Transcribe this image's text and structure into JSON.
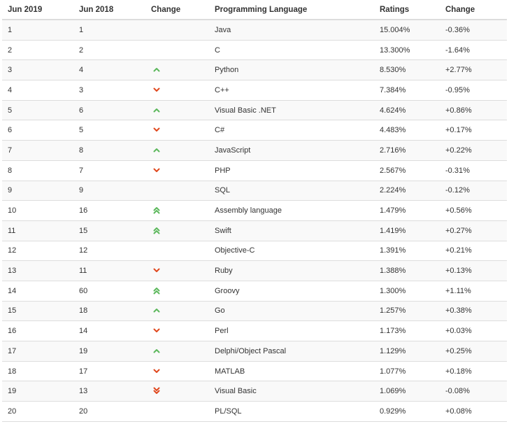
{
  "table": {
    "headers": [
      "Jun 2019",
      "Jun 2018",
      "Change",
      "Programming Language",
      "Ratings",
      "Change"
    ],
    "rows": [
      {
        "rank_2019": "1",
        "rank_2018": "1",
        "trend": "none",
        "language": "Java",
        "rating": "15.004%",
        "change": "-0.36%"
      },
      {
        "rank_2019": "2",
        "rank_2018": "2",
        "trend": "none",
        "language": "C",
        "rating": "13.300%",
        "change": "-1.64%"
      },
      {
        "rank_2019": "3",
        "rank_2018": "4",
        "trend": "up",
        "language": "Python",
        "rating": "8.530%",
        "change": "+2.77%"
      },
      {
        "rank_2019": "4",
        "rank_2018": "3",
        "trend": "down",
        "language": "C++",
        "rating": "7.384%",
        "change": "-0.95%"
      },
      {
        "rank_2019": "5",
        "rank_2018": "6",
        "trend": "up",
        "language": "Visual Basic .NET",
        "rating": "4.624%",
        "change": "+0.86%"
      },
      {
        "rank_2019": "6",
        "rank_2018": "5",
        "trend": "down",
        "language": "C#",
        "rating": "4.483%",
        "change": "+0.17%"
      },
      {
        "rank_2019": "7",
        "rank_2018": "8",
        "trend": "up",
        "language": "JavaScript",
        "rating": "2.716%",
        "change": "+0.22%"
      },
      {
        "rank_2019": "8",
        "rank_2018": "7",
        "trend": "down",
        "language": "PHP",
        "rating": "2.567%",
        "change": "-0.31%"
      },
      {
        "rank_2019": "9",
        "rank_2018": "9",
        "trend": "none",
        "language": "SQL",
        "rating": "2.224%",
        "change": "-0.12%"
      },
      {
        "rank_2019": "10",
        "rank_2018": "16",
        "trend": "up2",
        "language": "Assembly language",
        "rating": "1.479%",
        "change": "+0.56%"
      },
      {
        "rank_2019": "11",
        "rank_2018": "15",
        "trend": "up2",
        "language": "Swift",
        "rating": "1.419%",
        "change": "+0.27%"
      },
      {
        "rank_2019": "12",
        "rank_2018": "12",
        "trend": "none",
        "language": "Objective-C",
        "rating": "1.391%",
        "change": "+0.21%"
      },
      {
        "rank_2019": "13",
        "rank_2018": "11",
        "trend": "down",
        "language": "Ruby",
        "rating": "1.388%",
        "change": "+0.13%"
      },
      {
        "rank_2019": "14",
        "rank_2018": "60",
        "trend": "up2",
        "language": "Groovy",
        "rating": "1.300%",
        "change": "+1.11%"
      },
      {
        "rank_2019": "15",
        "rank_2018": "18",
        "trend": "up",
        "language": "Go",
        "rating": "1.257%",
        "change": "+0.38%"
      },
      {
        "rank_2019": "16",
        "rank_2018": "14",
        "trend": "down",
        "language": "Perl",
        "rating": "1.173%",
        "change": "+0.03%"
      },
      {
        "rank_2019": "17",
        "rank_2018": "19",
        "trend": "up",
        "language": "Delphi/Object Pascal",
        "rating": "1.129%",
        "change": "+0.25%"
      },
      {
        "rank_2019": "18",
        "rank_2018": "17",
        "trend": "down",
        "language": "MATLAB",
        "rating": "1.077%",
        "change": "+0.18%"
      },
      {
        "rank_2019": "19",
        "rank_2018": "13",
        "trend": "down2",
        "language": "Visual Basic",
        "rating": "1.069%",
        "change": "-0.08%"
      },
      {
        "rank_2019": "20",
        "rank_2018": "20",
        "trend": "none",
        "language": "PL/SQL",
        "rating": "0.929%",
        "change": "+0.08%"
      }
    ]
  },
  "icons": {
    "up": "chevron-up-icon",
    "up2": "double-chevron-up-icon",
    "down": "chevron-down-icon",
    "down2": "double-chevron-down-icon"
  },
  "colors": {
    "up": "#5cb85c",
    "down": "#e0481e",
    "text": "#333333",
    "row_stripe": "#f9f9f9",
    "border": "#dddddd"
  }
}
